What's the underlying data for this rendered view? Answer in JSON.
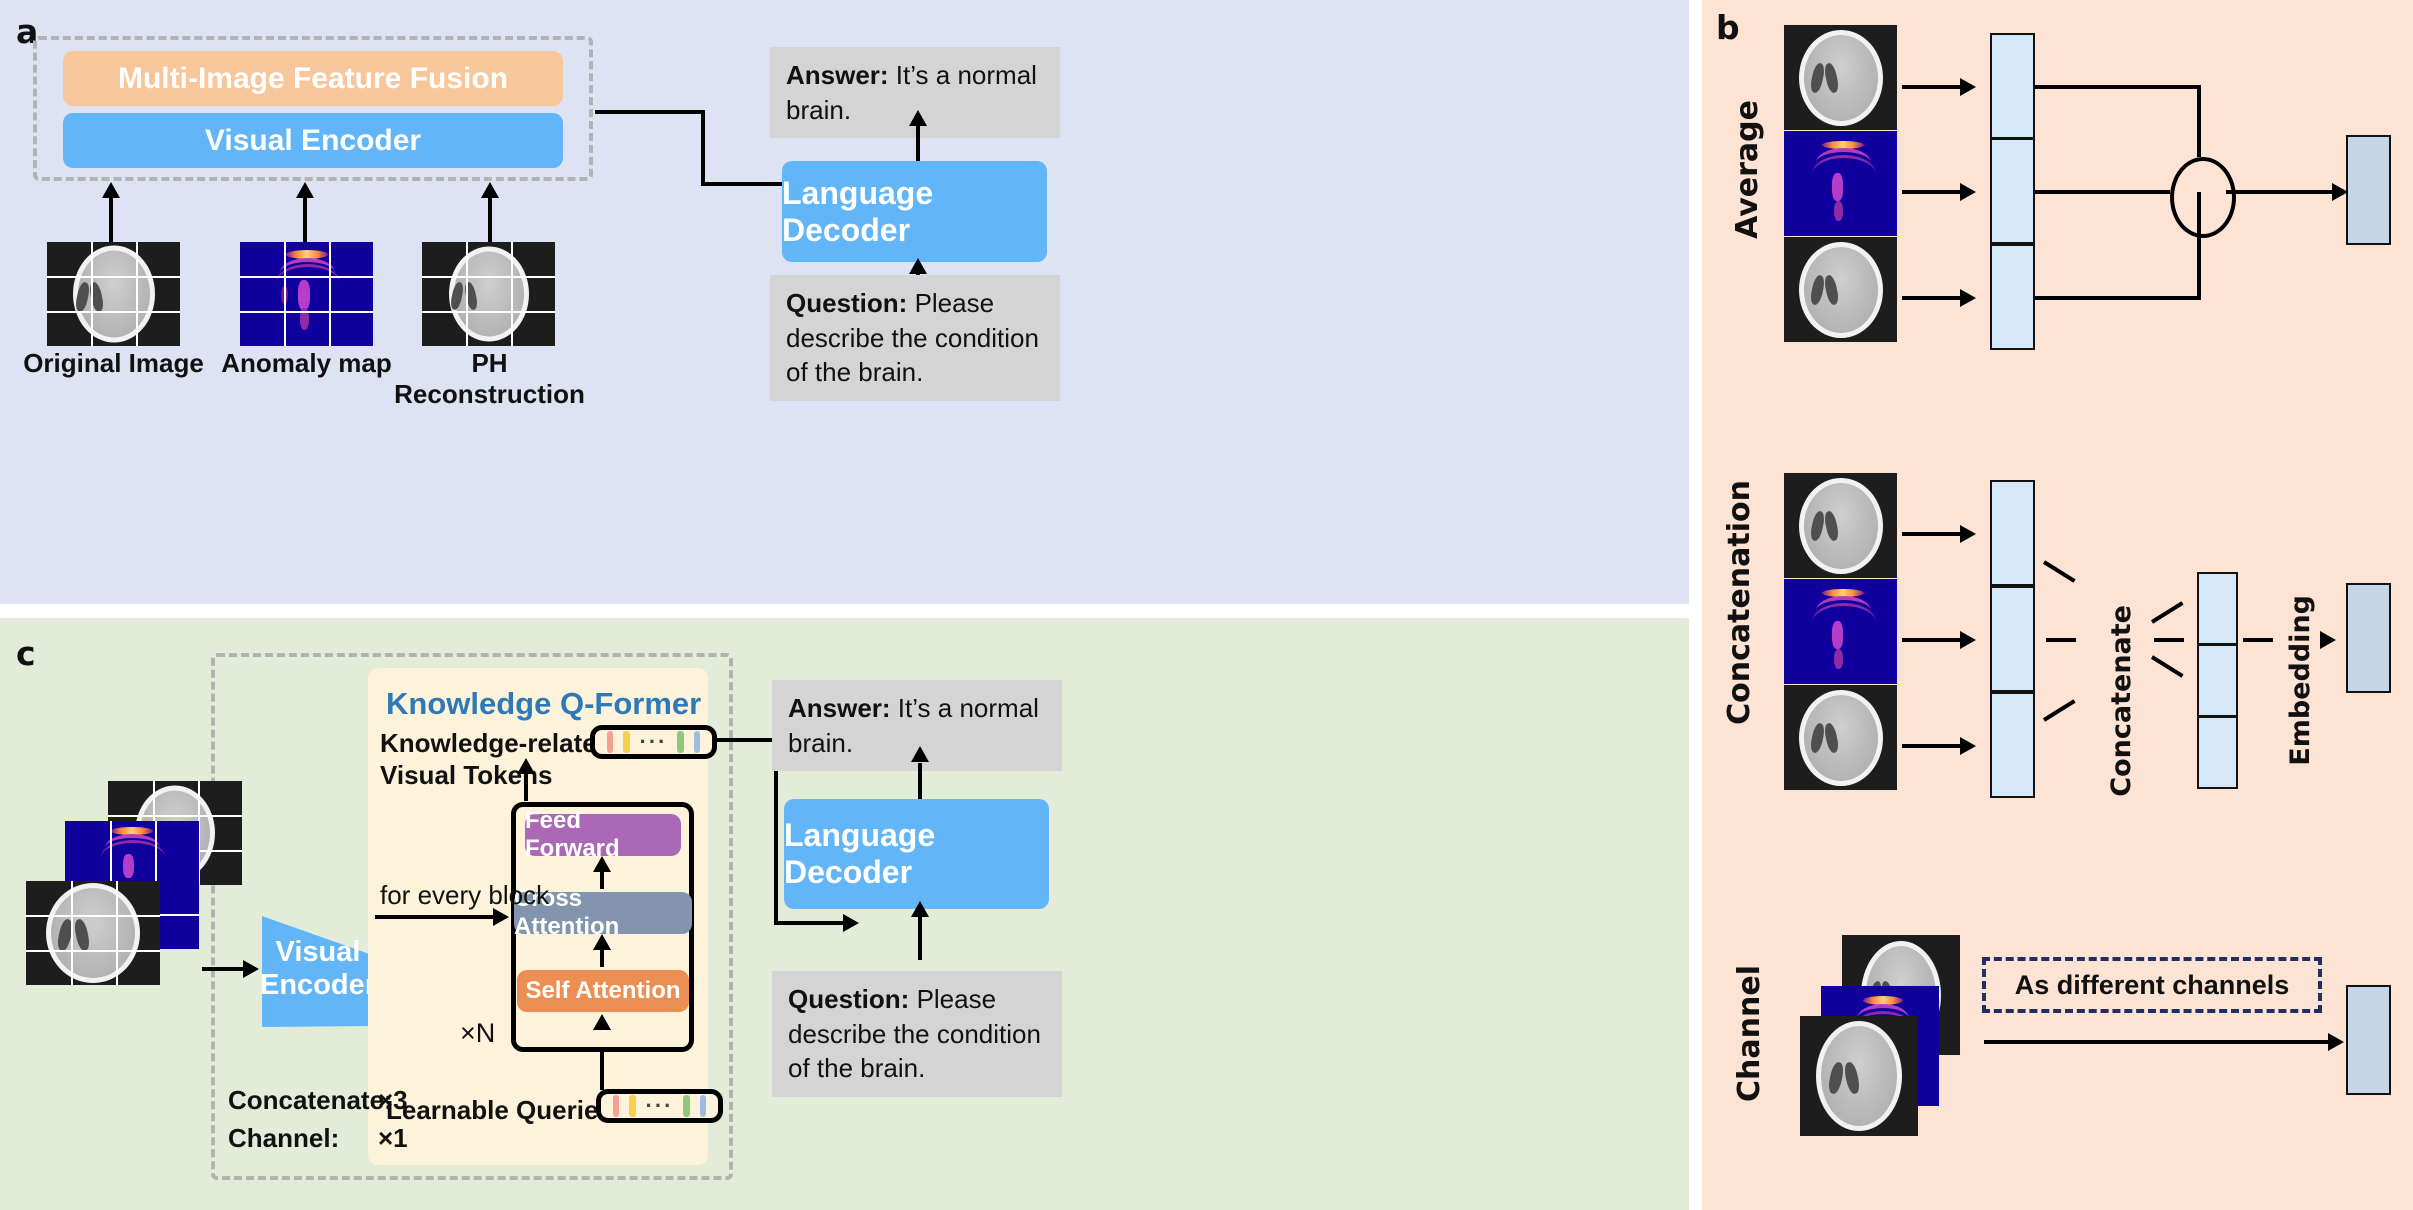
{
  "figure": {
    "panels": [
      {
        "id": "a",
        "label": "a"
      },
      {
        "id": "b",
        "label": "b"
      },
      {
        "id": "c",
        "label": "c"
      }
    ]
  },
  "panel_a": {
    "label": "a",
    "fusion_block": "Multi-Image Feature Fusion",
    "encoder_block": "Visual Encoder",
    "inputs": [
      {
        "caption": "Original Image",
        "type": "mri-grayscale"
      },
      {
        "caption": "Anomaly map",
        "type": "anomaly-heatmap"
      },
      {
        "caption": "PH Reconstruction",
        "type": "mri-grayscale"
      }
    ],
    "decoder_block": "Language Decoder",
    "answer_prefix": "Answer:",
    "answer_text": " It’s a normal brain.",
    "question_prefix": "Question:",
    "question_text": " Please describe the condition of the brain."
  },
  "panel_b": {
    "label": "b",
    "rows": [
      {
        "name": "Average",
        "inputs": [
          "mri-grayscale",
          "anomaly-heatmap",
          "mri-grayscale"
        ],
        "operator": "plus-circle",
        "output": "embedding-bar"
      },
      {
        "name": "Concatenation",
        "inputs": [
          "mri-grayscale",
          "anomaly-heatmap",
          "mri-grayscale"
        ],
        "middle_label": "Concatenate",
        "right_label": "Embedding",
        "output": "embedding-bar"
      },
      {
        "name": "Channel",
        "inputs": [
          "mri-grayscale",
          "anomaly-heatmap",
          "mri-grayscale"
        ],
        "note": "As different channels",
        "output": "embedding-bar"
      }
    ]
  },
  "panel_c": {
    "label": "c",
    "encoder_block": "Visual\nEncoder",
    "encoder_line1": "Visual",
    "encoder_line2": "Encoder",
    "qformer_title": "Knowledge Q-Former",
    "tokens_label_line1": "Knowledge-related",
    "tokens_label_line2": "Visual Tokens",
    "for_every_block": "for every block",
    "blocks": [
      "Feed Forward",
      "Cross Attention",
      "Self Attention"
    ],
    "repeat_label": "×N",
    "learnable_queries": "Learnable Queries",
    "settings": [
      {
        "name": "Concatenate:",
        "value": "×3"
      },
      {
        "name": "Channel:",
        "value": "×1"
      }
    ],
    "decoder_block": "Language Decoder",
    "answer_prefix": "Answer:",
    "answer_text": " It’s a normal brain.",
    "question_prefix": "Question:",
    "question_text": " Please describe the condition of the brain."
  },
  "colors": {
    "panel_a_bg": "#dde3f3",
    "panel_b_bg": "#fce3d4",
    "panel_c_bg": "#e3ecd8",
    "fusion_orange": "#f8c69b",
    "encoder_blue": "#62b6f7",
    "qa_gray": "#d4d4d4",
    "qformer_cream": "#fdf3db",
    "feed_forward_purple": "#ab68b6",
    "cross_attention_slate": "#8295ad",
    "self_attention_orange": "#ec8f53",
    "qformer_title_blue": "#2e7ab8",
    "feature_bar": "#d6e7f7",
    "embedding_bar": "#c6d6e6"
  },
  "tokens": {
    "swatches": [
      "#f4a093",
      "#f7cf4e",
      "#8fc878",
      "#9fbbe2"
    ],
    "ellipsis": "···"
  }
}
